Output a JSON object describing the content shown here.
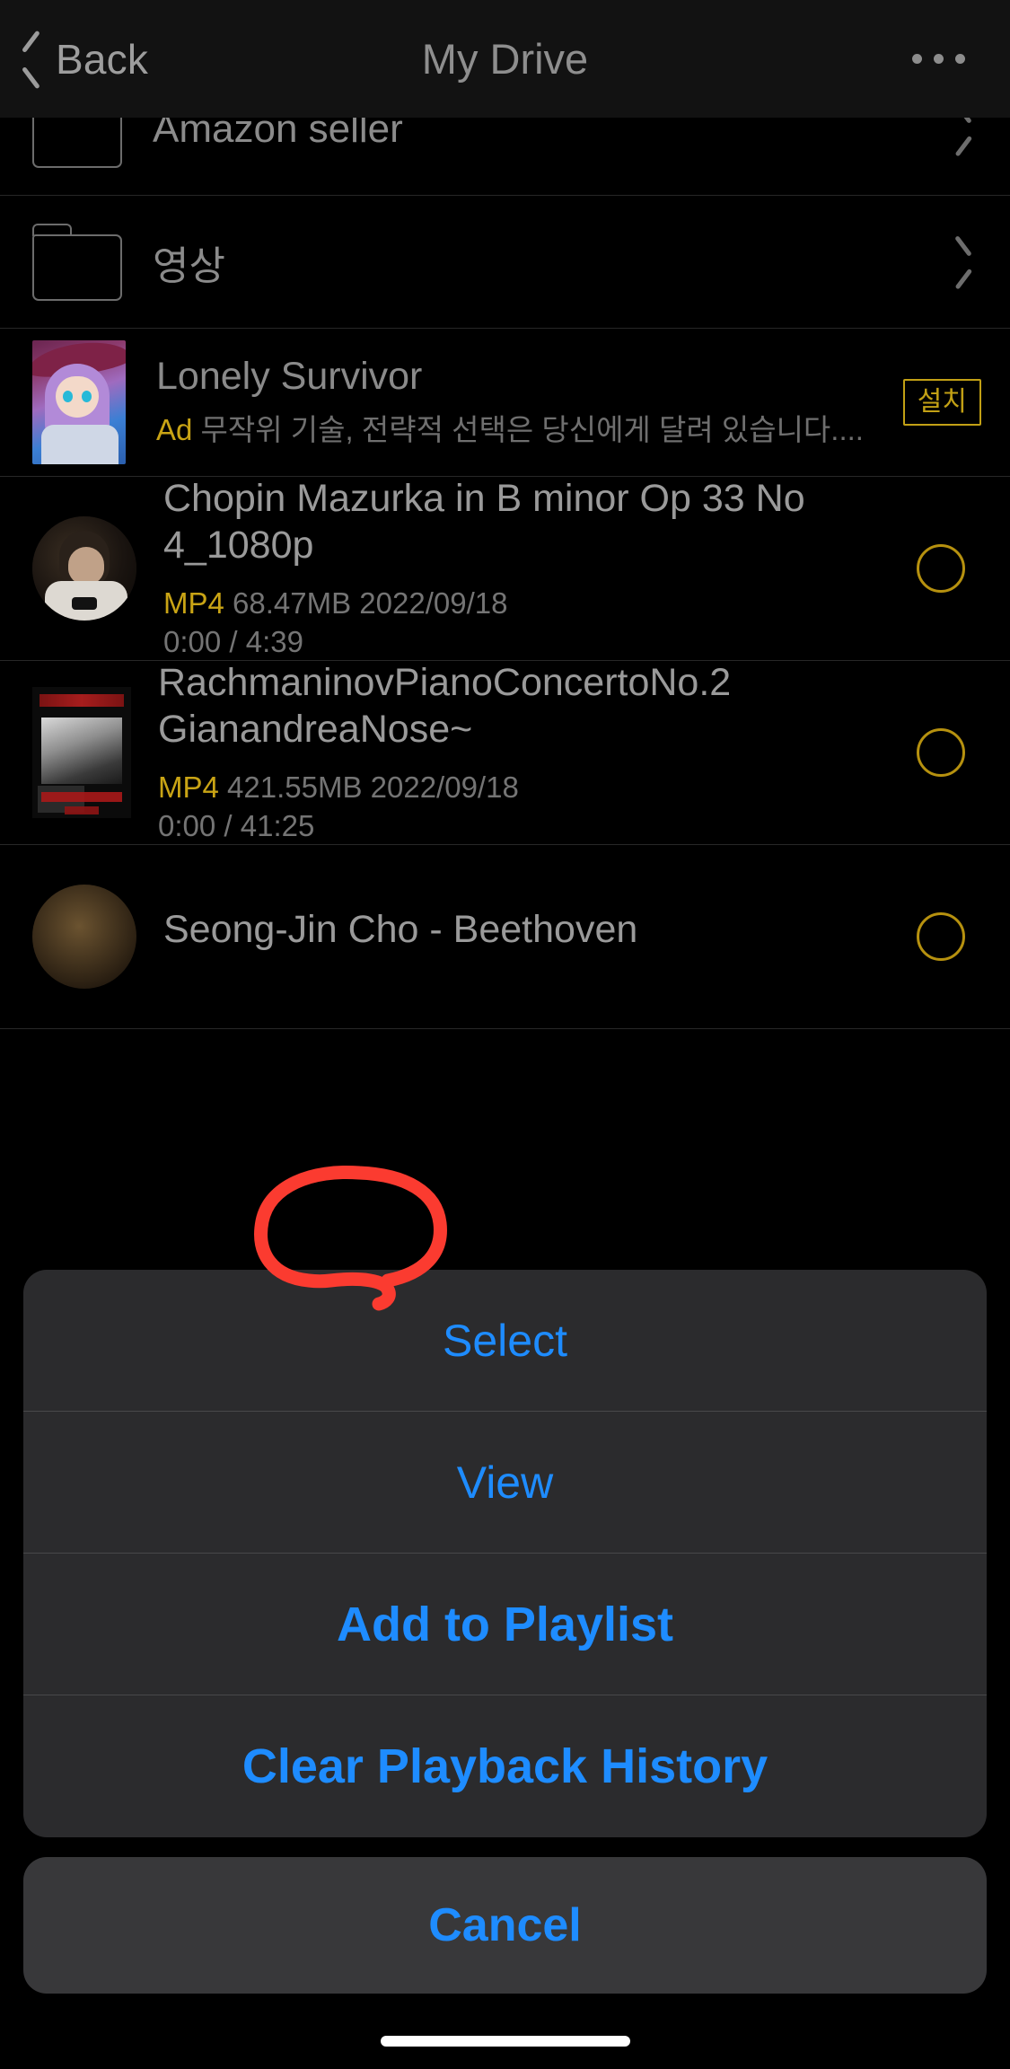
{
  "navbar": {
    "back_label": "Back",
    "title": "My Drive",
    "more_icon": "ellipsis-icon"
  },
  "list": {
    "folders": [
      {
        "name": "Amazon seller",
        "icon": "folder-icon",
        "accessory": "chevron-right-icon"
      },
      {
        "name": "영상",
        "icon": "folder-icon",
        "accessory": "chevron-right-icon"
      }
    ],
    "ad": {
      "title": "Lonely Survivor",
      "badge": "Ad",
      "description": "무작위 기술, 전략적 선택은 당신에게 달려 있습니다....",
      "install_label": "설치",
      "badge_color": "#c9a415",
      "install_border_color": "#c2a015"
    },
    "media": [
      {
        "title": "Chopin Mazurka in B minor Op 33 No 4_1080p",
        "format": "MP4",
        "size": "68.47MB",
        "date": "2022/09/18",
        "progress": "0:00 / 4:39",
        "radio_state": "unselected"
      },
      {
        "title": "RachmaninovPianoConcertoNo.2 GianandreaNose~",
        "format": "MP4",
        "size": "421.55MB",
        "date": "2022/09/18",
        "progress": "0:00 / 41:25",
        "radio_state": "unselected"
      }
    ],
    "partially_hidden_title": "Seong-Jin Cho - Beethoven"
  },
  "action_sheet": {
    "items": [
      {
        "label": "Select",
        "emphasis": "regular"
      },
      {
        "label": "View",
        "emphasis": "regular"
      },
      {
        "label": "Add to Playlist",
        "emphasis": "strong"
      },
      {
        "label": "Clear Playback History",
        "emphasis": "strong"
      }
    ],
    "cancel_label": "Cancel",
    "accent_color": "#1e8cff"
  },
  "annotation": {
    "shape": "hand-drawn-circle",
    "color": "#fb3b30",
    "targets": "Select"
  }
}
